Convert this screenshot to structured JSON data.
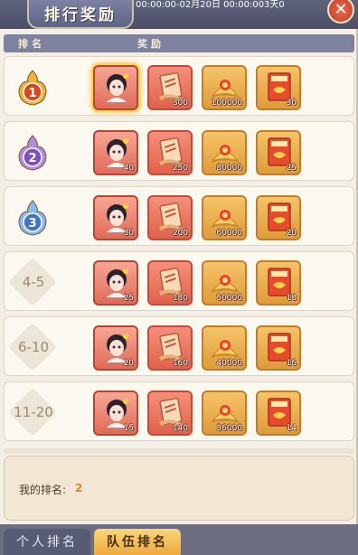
{
  "header": {
    "title": "排行奖励",
    "time_text": "00:00:00-02月20日 00:00:003天0",
    "close_label": "✕"
  },
  "columns": {
    "rank": "排名",
    "reward": "奖励"
  },
  "rows": [
    {
      "rank_label": "",
      "rank_icon": "rank-1-medal-icon",
      "rewards": [
        {
          "icon": "character-portrait-icon",
          "qty": ""
        },
        {
          "icon": "scroll-ticket-icon",
          "qty": "300"
        },
        {
          "icon": "gold-orb-icon",
          "qty": "100000"
        },
        {
          "icon": "time-card-icon",
          "qty": "30"
        }
      ]
    },
    {
      "rank_label": "",
      "rank_icon": "rank-2-medal-icon",
      "rewards": [
        {
          "icon": "character-portrait-icon",
          "qty": "40"
        },
        {
          "icon": "scroll-ticket-icon",
          "qty": "250"
        },
        {
          "icon": "gold-orb-icon",
          "qty": "80000"
        },
        {
          "icon": "time-card-icon",
          "qty": "25"
        }
      ]
    },
    {
      "rank_label": "",
      "rank_icon": "rank-3-medal-icon",
      "rewards": [
        {
          "icon": "character-portrait-icon",
          "qty": "30"
        },
        {
          "icon": "scroll-ticket-icon",
          "qty": "200"
        },
        {
          "icon": "gold-orb-icon",
          "qty": "60000"
        },
        {
          "icon": "time-card-icon",
          "qty": "20"
        }
      ]
    },
    {
      "rank_label": "4-5",
      "rank_icon": "",
      "rewards": [
        {
          "icon": "character-portrait-icon",
          "qty": "25"
        },
        {
          "icon": "scroll-ticket-icon",
          "qty": "180"
        },
        {
          "icon": "gold-orb-icon",
          "qty": "50000"
        },
        {
          "icon": "time-card-icon",
          "qty": "18"
        }
      ]
    },
    {
      "rank_label": "6-10",
      "rank_icon": "",
      "rewards": [
        {
          "icon": "character-portrait-icon",
          "qty": "20"
        },
        {
          "icon": "scroll-ticket-icon",
          "qty": "160"
        },
        {
          "icon": "gold-orb-icon",
          "qty": "40000"
        },
        {
          "icon": "time-card-icon",
          "qty": "16"
        }
      ]
    },
    {
      "rank_label": "11-20",
      "rank_icon": "",
      "rewards": [
        {
          "icon": "character-portrait-icon",
          "qty": "15"
        },
        {
          "icon": "scroll-ticket-icon",
          "qty": "140"
        },
        {
          "icon": "gold-orb-icon",
          "qty": "36000"
        },
        {
          "icon": "time-card-icon",
          "qty": "14"
        }
      ]
    }
  ],
  "my_rank": {
    "label": "我的排名:",
    "value": "2"
  },
  "tabs": [
    {
      "label": "个人排名",
      "active": false
    },
    {
      "label": "队伍排名",
      "active": true
    }
  ],
  "colors": {
    "accent": "#e0822a",
    "title_bar": "#4b4e66",
    "panel": "#f3efe6"
  }
}
